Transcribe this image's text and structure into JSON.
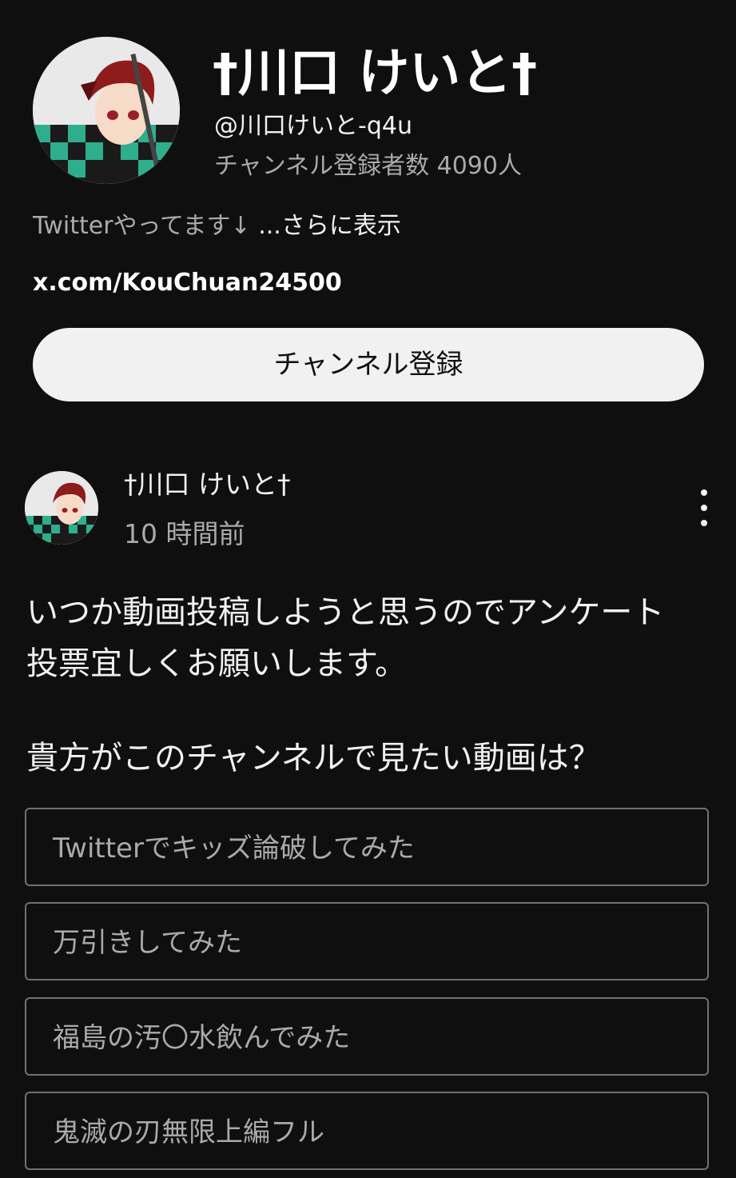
{
  "channel": {
    "name": "†川口 けいと†",
    "handle": "@川口けいと-q4u",
    "subscribers": "チャンネル登録者数 4090人",
    "description": "Twitterやってます↓",
    "more_label": "...さらに表示",
    "link": "x.com/KouChuan24500",
    "subscribe_label": "チャンネル登録"
  },
  "post": {
    "author": "†川口 けいと†",
    "time": "10 時間前",
    "menu_icon": "more-vert-icon",
    "body_lines": [
      "いつか動画投稿しようと思うのでアンケート",
      "投票宜しくお願いします。"
    ],
    "poll": {
      "question": "貴方がこのチャンネルで見たい動画は？",
      "options": [
        "Twitterでキッズ論破してみた",
        "万引きしてみた",
        "福島の汚〇水飲んでみた",
        "鬼滅の刃無限上編フル"
      ]
    }
  },
  "colors": {
    "background": "#0f0f0f",
    "primary_text": "#f1f1f1",
    "secondary_text": "#aaaaaa",
    "subscribe_bg": "#f1f1f1",
    "poll_border": "#717171"
  }
}
